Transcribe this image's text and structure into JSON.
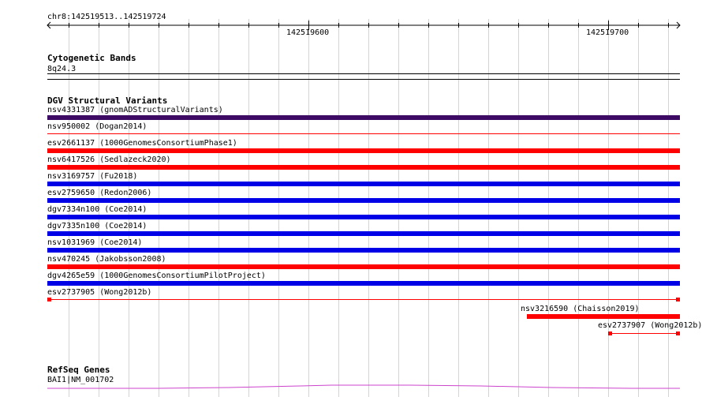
{
  "ruler": {
    "location": "chr8:142519513..142519724",
    "ticks": [
      {
        "label": "142519600",
        "pos": 142519600
      },
      {
        "label": "142519700",
        "pos": 142519700
      }
    ]
  },
  "cytoband": {
    "title": "Cytogenetic Bands",
    "band": "8q24.3"
  },
  "dgv": {
    "title": "DGV Structural Variants",
    "colors": {
      "purple": "#3d0b63",
      "red": "#ff0000",
      "blue": "#0000e6"
    },
    "variants": [
      {
        "label": "nsv4331387 (gnomADStructuralVariants)",
        "color": "purple",
        "style": "thick"
      },
      {
        "label": "nsv950002 (Dogan2014)",
        "color": "red",
        "style": "thin"
      },
      {
        "label": "esv2661137 (1000GenomesConsortiumPhase1)",
        "color": "red",
        "style": "thick"
      },
      {
        "label": "nsv6417526 (Sedlazeck2020)",
        "color": "red",
        "style": "thick"
      },
      {
        "label": "nsv3169757 (Fu2018)",
        "color": "blue",
        "style": "thick"
      },
      {
        "label": "esv2759650 (Redon2006)",
        "color": "blue",
        "style": "thick"
      },
      {
        "label": "dgv7334n100 (Coe2014)",
        "color": "blue",
        "style": "thick"
      },
      {
        "label": "dgv7335n100 (Coe2014)",
        "color": "blue",
        "style": "thick"
      },
      {
        "label": "nsv1031969 (Coe2014)",
        "color": "blue",
        "style": "thick"
      },
      {
        "label": "nsv470245 (Jakobsson2008)",
        "color": "red",
        "style": "thick"
      },
      {
        "label": "dgv4265e59 (1000GenomesConsortiumPilotProject)",
        "color": "blue",
        "style": "thick"
      },
      {
        "label": "esv2737905 (Wong2012b)",
        "color": "red",
        "style": "capped"
      },
      {
        "label": "nsv3216590 (Chaisson2019)",
        "color": "red",
        "style": "thick"
      },
      {
        "label": "esv2737907 (Wong2012b)",
        "color": "red",
        "style": "capped"
      }
    ]
  },
  "refseq": {
    "title": "RefSeq Genes",
    "gene": "BAI1|NM_001702",
    "color": "#cc44cc"
  }
}
